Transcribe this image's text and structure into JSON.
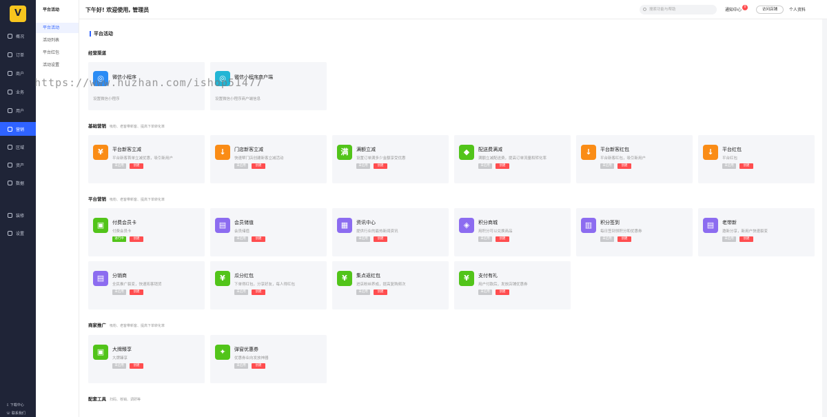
{
  "app": {
    "logo_glyph": "V"
  },
  "leftnav": {
    "items": [
      {
        "label": "概况",
        "icon": "overview-icon"
      },
      {
        "label": "订单",
        "icon": "order-icon"
      },
      {
        "label": "商户",
        "icon": "merchant-icon"
      },
      {
        "label": "业务",
        "icon": "business-icon"
      },
      {
        "label": "用户",
        "icon": "user-icon"
      },
      {
        "label": "营销",
        "icon": "marketing-icon"
      },
      {
        "label": "区域",
        "icon": "region-icon"
      },
      {
        "label": "资产",
        "icon": "asset-icon"
      },
      {
        "label": "数据",
        "icon": "data-icon"
      },
      {
        "label": "装修",
        "icon": "decorate-icon"
      },
      {
        "label": "设置",
        "icon": "settings-icon"
      }
    ],
    "active_index": 5,
    "bottom": {
      "download": "下载中心",
      "contact": "联系我们"
    }
  },
  "subnav": {
    "title": "平台活动",
    "items": [
      "平台活动",
      "活动列表",
      "平台红包",
      "活动设置"
    ],
    "active_index": 0
  },
  "topbar": {
    "greeting": "下午好! 欢迎使用, 管理员",
    "search_placeholder": "搜索功能与帮助",
    "notify_label": "通知中心",
    "notify_count": "0",
    "visit_label": "访问店铺",
    "profile_label": "个人资料"
  },
  "page": {
    "title": "平台活动"
  },
  "watermark": "https://www.huzhan.com/ishop51477",
  "status": {
    "not_started": "未启用",
    "running": "进行中",
    "create": "创建"
  },
  "sections": {
    "channels": {
      "title": "经营渠道",
      "sub": "",
      "cards": [
        {
          "title": "微信小程序",
          "desc": "设置微信小程序",
          "color": "#2b8cf5",
          "glyph": "◎"
        },
        {
          "title": "微信小程序商户端",
          "desc": "设置微信小程序商户端信息",
          "color": "#22b5d5",
          "glyph": "◎"
        }
      ]
    },
    "basic": {
      "title": "基础营销",
      "sub": "吸粉、老客带新客、提高下单转化率",
      "cards": [
        {
          "title": "平台新客立减",
          "desc": "平台新客首单立减优惠，吸引新用户",
          "color": "#fa8c16",
          "glyph": "¥",
          "status": "未启用"
        },
        {
          "title": "门店新客立减",
          "desc": "快速帮门店创建新客立减活动",
          "color": "#fa8c16",
          "glyph": "↓",
          "status": "未启用"
        },
        {
          "title": "满额立减",
          "desc": "设置订单满多少金额享受优惠",
          "color": "#52c41a",
          "glyph": "满",
          "status": "未启用"
        },
        {
          "title": "配送费满减",
          "desc": "满额立减配送费，提高订单流量和转化率",
          "color": "#52c41a",
          "glyph": "◆",
          "status": "未启用"
        },
        {
          "title": "平台新客红包",
          "desc": "平台新客红包，吸引新用户",
          "color": "#fa8c16",
          "glyph": "↓",
          "status": "未启用"
        },
        {
          "title": "平台红包",
          "desc": "平台红包",
          "color": "#fa8c16",
          "glyph": "↓",
          "status": "未启用"
        }
      ]
    },
    "platform": {
      "title": "平台营销",
      "sub": "吸粉、老客带新客、提高下单转化率",
      "cards": [
        {
          "title": "付费会员卡",
          "desc": "付费会员卡",
          "color": "#52c41a",
          "glyph": "▣",
          "status": "进行中"
        },
        {
          "title": "会员储值",
          "desc": "会员储值",
          "color": "#8c6cf0",
          "glyph": "▤",
          "status": "未启用"
        },
        {
          "title": "资讯中心",
          "desc": "提供行业的最热新闻资讯",
          "color": "#8c6cf0",
          "glyph": "▦",
          "status": "未启用"
        },
        {
          "title": "积分商城",
          "desc": "用积分可以兑换商品",
          "color": "#8c6cf0",
          "glyph": "◈",
          "status": "未启用"
        },
        {
          "title": "积分签到",
          "desc": "每日签到领积分和优惠券",
          "color": "#8c6cf0",
          "glyph": "▥",
          "status": "未启用"
        },
        {
          "title": "老带新",
          "desc": "邀新分享，新用户快速裂变",
          "color": "#8c6cf0",
          "glyph": "▤",
          "status": "未启用"
        },
        {
          "title": "分销商",
          "desc": "全民推广裂变，快速拓客销货",
          "color": "#8c6cf0",
          "glyph": "▤",
          "status": "未启用"
        },
        {
          "title": "瓜分红包",
          "desc": "下单得红包，分享好友，每人得红包",
          "color": "#52c41a",
          "glyph": "¥",
          "status": "未启用"
        },
        {
          "title": "集点返红包",
          "desc": "进店粉丝养成，提高复购频次",
          "color": "#52c41a",
          "glyph": "¥",
          "status": "未启用"
        },
        {
          "title": "支付有礼",
          "desc": "用户付款后，发放店铺优惠券",
          "color": "#52c41a",
          "glyph": "¥",
          "status": "未启用"
        }
      ]
    },
    "merchant": {
      "title": "商家推广",
      "sub": "吸粉、老客带新客、提高下单转化率",
      "cards": [
        {
          "title": "大牌臻享",
          "desc": "大牌臻享",
          "color": "#52c41a",
          "glyph": "▣",
          "status": "未启用"
        },
        {
          "title": "弹窗优惠券",
          "desc": "优惠券业向发放神器",
          "color": "#52c41a",
          "glyph": "✦",
          "status": "未启用"
        }
      ]
    },
    "tools": {
      "title": "配套工具",
      "sub": "扫码、核销、调研等"
    }
  }
}
